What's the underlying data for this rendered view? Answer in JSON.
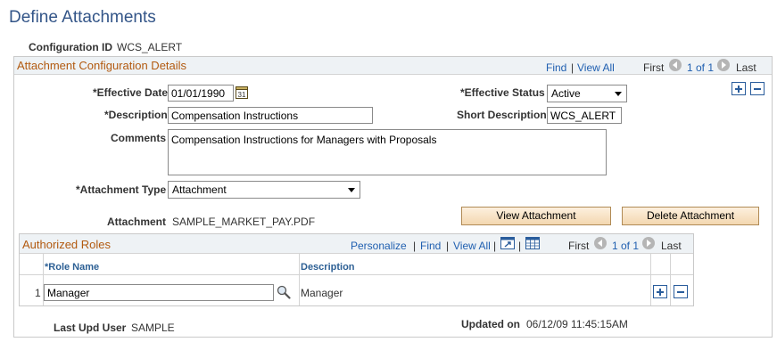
{
  "page": {
    "title": "Define Attachments"
  },
  "config": {
    "label": "Configuration ID",
    "value": "WCS_ALERT"
  },
  "details": {
    "title": "Attachment Configuration Details",
    "find": "Find",
    "sep": "|",
    "view_all": "View All",
    "first": "First",
    "range": "1 of 1",
    "last": "Last",
    "effective_date_label": "*Effective Date",
    "effective_date_value": "01/01/1990",
    "effective_status_label": "*Effective Status",
    "effective_status_value": "Active",
    "description_label": "*Description",
    "description_value": "Compensation Instructions",
    "short_description_label": "Short Description",
    "short_description_value": "WCS_ALERT",
    "comments_label": "Comments",
    "comments_value": "Compensation Instructions for Managers with Proposals",
    "attachment_type_label": "*Attachment Type",
    "attachment_type_value": "Attachment",
    "attachment_label": "Attachment",
    "attachment_value": "SAMPLE_MARKET_PAY.PDF",
    "view_attachment": "View Attachment",
    "delete_attachment": "Delete Attachment"
  },
  "roles": {
    "title": "Authorized Roles",
    "personalize": "Personalize",
    "find": "Find",
    "sep": "|",
    "view_all": "View All",
    "first": "First",
    "range": "1 of 1",
    "last": "Last",
    "col_role": "*Role Name",
    "col_desc": "Description",
    "rows": [
      {
        "num": "1",
        "role": "Manager",
        "description": "Manager"
      }
    ]
  },
  "footer": {
    "last_upd_label": "Last Upd User",
    "last_upd_value": "SAMPLE",
    "updated_on_label": "Updated on",
    "updated_on_value": "06/12/09 11:45:15AM"
  },
  "icons": {
    "calendar": "calendar-icon",
    "lookup": "magnifier-icon",
    "zoom": "new-window-icon",
    "grid": "spreadsheet-icon"
  },
  "colors": {
    "accent": "#335588",
    "section_title": "#b25a10",
    "link": "#1f5fb0",
    "button": "#f3d7b0"
  }
}
